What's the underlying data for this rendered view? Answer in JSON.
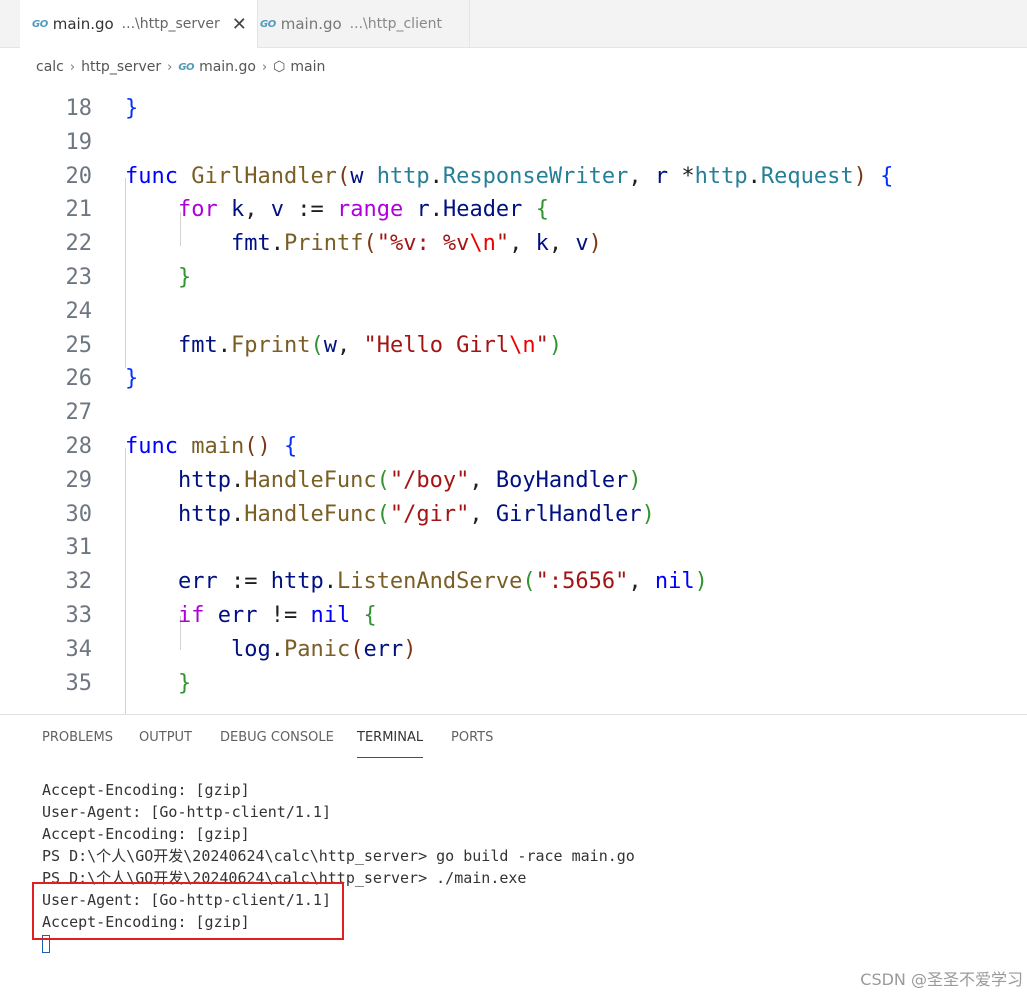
{
  "tabs": [
    {
      "icon": "go-file-icon",
      "icon_text": "GO",
      "name": "main.go",
      "path": "...\\http_server",
      "close": "✕",
      "active": true
    },
    {
      "icon": "go-file-icon",
      "icon_text": "GO",
      "name": "main.go",
      "path": "...\\http_client",
      "active": false
    }
  ],
  "breadcrumb": {
    "items": [
      "calc",
      "http_server",
      "main.go",
      "main"
    ],
    "sep": "›",
    "go_icon_text": "GO",
    "symbol_icon": "⬡"
  },
  "editor": {
    "lines": [
      {
        "n": "18",
        "parts": [
          {
            "t": "}",
            "c": "brace1"
          }
        ]
      },
      {
        "n": "19",
        "parts": []
      },
      {
        "n": "20",
        "parts": [
          {
            "t": "func",
            "c": "kw"
          },
          {
            "t": " "
          },
          {
            "t": "GirlHandler",
            "c": "fn"
          },
          {
            "t": "(",
            "c": "brace3"
          },
          {
            "t": "w",
            "c": "var"
          },
          {
            "t": " "
          },
          {
            "t": "http",
            "c": "pkg"
          },
          {
            "t": "."
          },
          {
            "t": "ResponseWriter",
            "c": "pkg"
          },
          {
            "t": ", "
          },
          {
            "t": "r",
            "c": "var"
          },
          {
            "t": " *"
          },
          {
            "t": "http",
            "c": "pkg"
          },
          {
            "t": "."
          },
          {
            "t": "Request",
            "c": "pkg"
          },
          {
            "t": ")",
            "c": "brace3"
          },
          {
            "t": " "
          },
          {
            "t": "{",
            "c": "brace1"
          }
        ]
      },
      {
        "n": "21",
        "parts": [
          {
            "t": "    "
          },
          {
            "t": "for",
            "c": "kw2"
          },
          {
            "t": " "
          },
          {
            "t": "k",
            "c": "var"
          },
          {
            "t": ", "
          },
          {
            "t": "v",
            "c": "var"
          },
          {
            "t": " := "
          },
          {
            "t": "range",
            "c": "kw2"
          },
          {
            "t": " "
          },
          {
            "t": "r",
            "c": "var"
          },
          {
            "t": "."
          },
          {
            "t": "Header",
            "c": "var"
          },
          {
            "t": " "
          },
          {
            "t": "{",
            "c": "brace2"
          }
        ]
      },
      {
        "n": "22",
        "parts": [
          {
            "t": "        "
          },
          {
            "t": "fmt",
            "c": "var"
          },
          {
            "t": "."
          },
          {
            "t": "Printf",
            "c": "fn"
          },
          {
            "t": "(",
            "c": "brace3"
          },
          {
            "t": "\"%v: %v",
            "c": "str"
          },
          {
            "t": "\\n",
            "c": "esc"
          },
          {
            "t": "\"",
            "c": "str"
          },
          {
            "t": ", "
          },
          {
            "t": "k",
            "c": "var"
          },
          {
            "t": ", "
          },
          {
            "t": "v",
            "c": "var"
          },
          {
            "t": ")",
            "c": "brace3"
          }
        ]
      },
      {
        "n": "23",
        "parts": [
          {
            "t": "    "
          },
          {
            "t": "}",
            "c": "brace2"
          }
        ]
      },
      {
        "n": "24",
        "parts": []
      },
      {
        "n": "25",
        "parts": [
          {
            "t": "    "
          },
          {
            "t": "fmt",
            "c": "var"
          },
          {
            "t": "."
          },
          {
            "t": "Fprint",
            "c": "fn"
          },
          {
            "t": "(",
            "c": "brace2"
          },
          {
            "t": "w",
            "c": "var"
          },
          {
            "t": ", "
          },
          {
            "t": "\"Hello Girl",
            "c": "str"
          },
          {
            "t": "\\n",
            "c": "esc"
          },
          {
            "t": "\"",
            "c": "str"
          },
          {
            "t": ")",
            "c": "brace2"
          }
        ]
      },
      {
        "n": "26",
        "parts": [
          {
            "t": "}",
            "c": "brace1"
          }
        ]
      },
      {
        "n": "27",
        "parts": []
      },
      {
        "n": "28",
        "parts": [
          {
            "t": "func",
            "c": "kw"
          },
          {
            "t": " "
          },
          {
            "t": "main",
            "c": "fn"
          },
          {
            "t": "()",
            "c": "brace3"
          },
          {
            "t": " "
          },
          {
            "t": "{",
            "c": "brace1"
          }
        ]
      },
      {
        "n": "29",
        "parts": [
          {
            "t": "    "
          },
          {
            "t": "http",
            "c": "var"
          },
          {
            "t": "."
          },
          {
            "t": "HandleFunc",
            "c": "fn"
          },
          {
            "t": "(",
            "c": "brace2"
          },
          {
            "t": "\"/boy\"",
            "c": "str"
          },
          {
            "t": ", "
          },
          {
            "t": "BoyHandler",
            "c": "var"
          },
          {
            "t": ")",
            "c": "brace2"
          }
        ]
      },
      {
        "n": "30",
        "parts": [
          {
            "t": "    "
          },
          {
            "t": "http",
            "c": "var"
          },
          {
            "t": "."
          },
          {
            "t": "HandleFunc",
            "c": "fn"
          },
          {
            "t": "(",
            "c": "brace2"
          },
          {
            "t": "\"/gir\"",
            "c": "str"
          },
          {
            "t": ", "
          },
          {
            "t": "GirlHandler",
            "c": "var"
          },
          {
            "t": ")",
            "c": "brace2"
          }
        ]
      },
      {
        "n": "31",
        "parts": []
      },
      {
        "n": "32",
        "parts": [
          {
            "t": "    "
          },
          {
            "t": "err",
            "c": "var"
          },
          {
            "t": " := "
          },
          {
            "t": "http",
            "c": "var"
          },
          {
            "t": "."
          },
          {
            "t": "ListenAndServe",
            "c": "fn"
          },
          {
            "t": "(",
            "c": "brace2"
          },
          {
            "t": "\":5656\"",
            "c": "str"
          },
          {
            "t": ", "
          },
          {
            "t": "nil",
            "c": "kw"
          },
          {
            "t": ")",
            "c": "brace2"
          }
        ]
      },
      {
        "n": "33",
        "parts": [
          {
            "t": "    "
          },
          {
            "t": "if",
            "c": "kw2"
          },
          {
            "t": " "
          },
          {
            "t": "err",
            "c": "var"
          },
          {
            "t": " != "
          },
          {
            "t": "nil",
            "c": "kw"
          },
          {
            "t": " "
          },
          {
            "t": "{",
            "c": "brace2"
          }
        ]
      },
      {
        "n": "34",
        "parts": [
          {
            "t": "        "
          },
          {
            "t": "log",
            "c": "var"
          },
          {
            "t": "."
          },
          {
            "t": "Panic",
            "c": "fn"
          },
          {
            "t": "(",
            "c": "brace3"
          },
          {
            "t": "err",
            "c": "var"
          },
          {
            "t": ")",
            "c": "brace3"
          }
        ]
      },
      {
        "n": "35",
        "parts": [
          {
            "t": "    "
          },
          {
            "t": "}",
            "c": "brace2"
          }
        ]
      }
    ]
  },
  "panel": {
    "tabs": [
      "PROBLEMS",
      "OUTPUT",
      "DEBUG CONSOLE",
      "TERMINAL",
      "PORTS"
    ],
    "active_tab": "TERMINAL",
    "terminal_lines": [
      "Accept-Encoding: [gzip]",
      "User-Agent: [Go-http-client/1.1]",
      "Accept-Encoding: [gzip]",
      "PS D:\\个人\\GO开发\\20240624\\calc\\http_server> go build -race main.go",
      "PS D:\\个人\\GO开发\\20240624\\calc\\http_server> ./main.exe",
      "User-Agent: [Go-http-client/1.1]",
      "Accept-Encoding: [gzip]"
    ]
  },
  "watermark": "CSDN @圣圣不爱学习"
}
